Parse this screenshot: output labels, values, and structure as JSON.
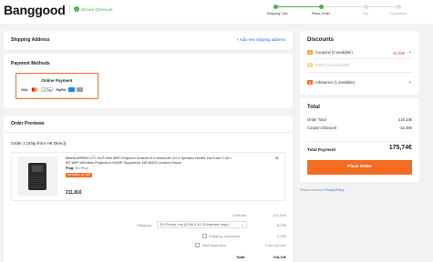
{
  "header": {
    "logo": "Banggood",
    "secure_label": "Secure Checkout",
    "steps": [
      {
        "label": "Shipping Cart",
        "done": true
      },
      {
        "label": "Place Order",
        "done": true
      },
      {
        "label": "Pay",
        "done": false
      },
      {
        "label": "Completed",
        "done": false
      }
    ]
  },
  "shipping_address": {
    "title": "Shipping Address",
    "add_link": "+ Add new shipping address"
  },
  "payment": {
    "title": "Payment Methods",
    "option_label": "Online Payment",
    "icons": [
      "VISA",
      "mastercard",
      "G Pay",
      "PayPal",
      "bank-card",
      "wire"
    ]
  },
  "order_preview": {
    "title": "Order Previews",
    "order_label": "Order 1 (Ship from HK Direct)",
    "item": {
      "name": "BlitzWolf®BW-VT2 DLP Mini WiFi Projector Android 9.0 bluetooth V4.2 Speaker Netflix YouTube 2.4G / 5G WiFi Wireless Projection 1080P Supported 150 ANSI Lumens Hand...",
      "plug_label": "Plug:",
      "plug_value": "EU Plug",
      "vat_badge": "Inclusive of VAT",
      "qty": "x1",
      "price": "211,81€"
    },
    "summary": {
      "subtotal_label": "Subtotal:",
      "subtotal_value": "211,81€",
      "shipping_label": "Shipping:",
      "shipping_option": "EU Priority Line (6,29€ & 10-25 business days)",
      "shipping_value": "6,29€",
      "insurance_label": "Shipping Insurance",
      "insurance_value": "4,24€",
      "tariff_label": "Tariff Insurance",
      "tariff_value": "Free Service",
      "total_label": "Total:",
      "total_value": "218,10€"
    }
  },
  "discounts": {
    "title": "Discounts",
    "coupons_label": "Coupons (0 available)",
    "coupons_value": "-42,36€",
    "points_label": "Points (Unavailable)",
    "allowance_label": "Allowance (1 available)"
  },
  "total": {
    "title": "Total",
    "order_total_label": "Order Total",
    "order_total_value": "218,10€",
    "coupon_discount_label": "Coupon Discount",
    "coupon_discount_value": "-42,36€",
    "total_payment_label": "Total Payment",
    "total_payment_value": "175,74€",
    "place_order_button": "Place Order"
  },
  "footer": {
    "privacy_prefix": "Please read our",
    "privacy_link": "Privacy Policy"
  },
  "colors": {
    "accent": "#f36c21",
    "success": "#4caf50",
    "link": "#2a6edb",
    "discount_red": "#e53935"
  }
}
